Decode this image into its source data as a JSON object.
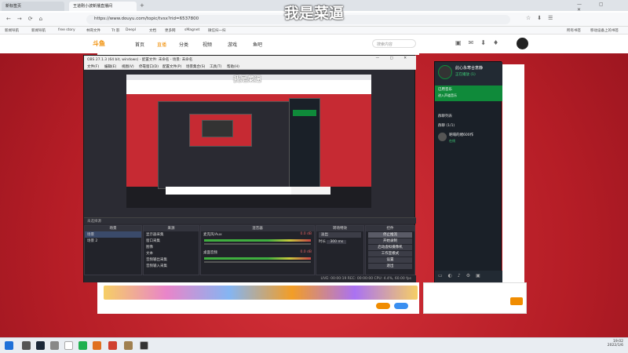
{
  "subtitle": "我是菜逼",
  "browser": {
    "tabs": [
      "新标签页",
      "王道刚小波新播直播间"
    ],
    "url": "https://www.douyu.com/topic/tvsx?rid=6537800",
    "bookmarks": [
      "新闻导航",
      "新闻导航",
      "free story",
      "林哥文件",
      "Tt 影",
      "Deepl",
      "文档",
      "更多网",
      "sMagnet",
      "微信扫一扫",
      "所有书签",
      "移动设备上的书签"
    ]
  },
  "site": {
    "logo": "斗鱼",
    "nav": [
      "首页",
      "直播",
      "分类",
      "视频",
      "游戏",
      "鱼吧"
    ],
    "search_placeholder": "搜索内容"
  },
  "obs": {
    "title": "OBS 27.1.3 (64 bit, windows) - 配置文件: 未命名 - 场景: 未命名",
    "menu": [
      "文件(F)",
      "编辑(E)",
      "视图(V)",
      "停靠窗口(D)",
      "配置文件(P)",
      "场景集合(S)",
      "工具(T)",
      "帮助(H)"
    ],
    "preview_caption": "我是菜逼",
    "source_label": "未选择源",
    "docks": {
      "scenes": {
        "title": "场景",
        "items": [
          "场景",
          "场景 2"
        ]
      },
      "sources": {
        "title": "来源",
        "items": [
          "显示器采集",
          "窗口采集",
          "图像",
          "文本",
          "音频输出采集",
          "音频输入采集"
        ]
      },
      "mixer": {
        "title": "混音器",
        "channels": [
          "麦克风/Aux",
          "桌面音频"
        ],
        "levels": [
          "0.0 dB",
          "0.0 dB"
        ]
      },
      "transitions": {
        "title": "转场特效",
        "type": "淡出",
        "duration_label": "时长",
        "duration": "300 ms"
      },
      "controls": {
        "title": "控件",
        "buttons": [
          "停止推流",
          "开始录制",
          "启动虚拟摄像机",
          "工作室模式",
          "设置",
          "退出"
        ]
      }
    },
    "status": "LIVE: 00:00:19   REC: 00:00:00   CPU: 4.4%, 60.00 fps"
  },
  "chat": {
    "username": "此心永寒合意静",
    "subtitle": "正在播放 (1)",
    "group_label": "已用音乐",
    "group_sub": "进入声道音乐",
    "list_title": "群聊列表",
    "section": "群聊 (1/1)",
    "member_name": "呢喃的绪600作",
    "member_status": "在线"
  },
  "taskbar": {
    "time": "19:02",
    "date": "2022/1/6"
  },
  "colors": {
    "page_red": "#c82630",
    "chat_green": "#0f8a3a",
    "accent_orange": "#f08c00"
  }
}
